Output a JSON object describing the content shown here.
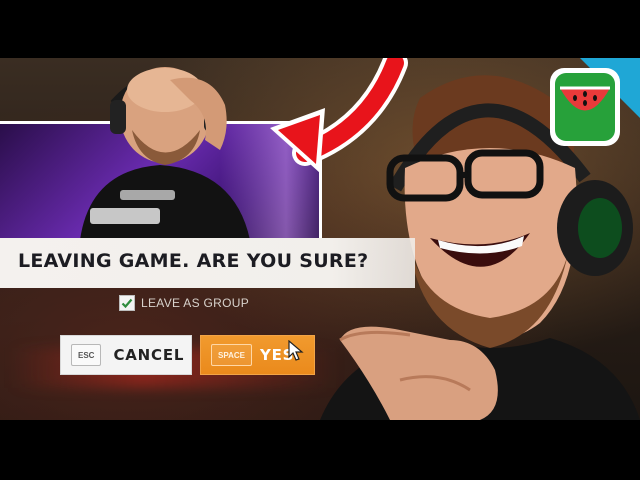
{
  "dialog": {
    "title": "LEAVING GAME. ARE YOU SURE?",
    "checkbox": {
      "label": "LEAVE AS GROUP",
      "checked": true
    },
    "cancel_button": {
      "key": "ESC",
      "label": "CANCEL"
    },
    "confirm_button": {
      "key": "SPACE",
      "label": "YES"
    }
  },
  "overlay": {
    "arrow_color": "#e8141b",
    "logo_icon": "watermelon-icon",
    "logo_background": "#1fa7d6",
    "confirm_button_color": "#ee9020"
  }
}
